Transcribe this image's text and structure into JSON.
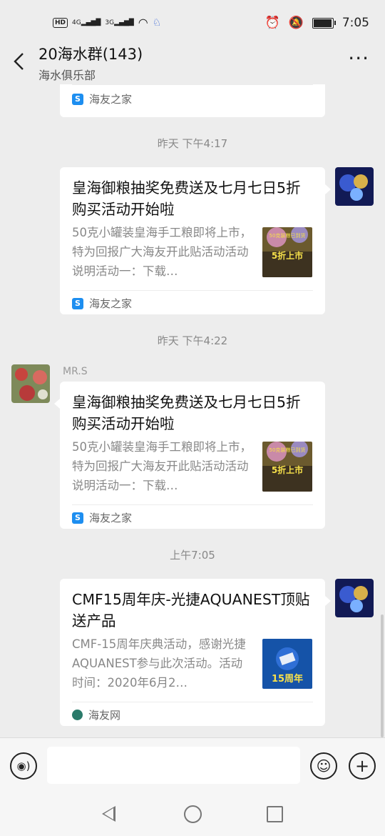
{
  "status_bar": {
    "hd_badge": "HD",
    "sim1": "4G",
    "sim2": "3G",
    "time": "7:05"
  },
  "header": {
    "title": "20海水群(143)",
    "subtitle": "海水俱乐部",
    "more_label": "···"
  },
  "messages": [
    {
      "kind": "partial-card",
      "source": "海友之家"
    },
    {
      "kind": "timestamp",
      "text": "昨天 下午4:17"
    },
    {
      "kind": "card",
      "side": "right",
      "title": "皇海御粮抽奖免费送及七月七日5折购买活动开始啦",
      "desc": "50克小罐装皇海手工粮即将上市，特为回报广大海友开此贴活动活动说明活动一：下载…",
      "thumb_caption_top": "50克装粮已到货",
      "thumb_caption": "5折上市",
      "source": "海友之家"
    },
    {
      "kind": "timestamp",
      "text": "昨天 下午4:22"
    },
    {
      "kind": "card",
      "side": "left",
      "sender": "MR.S",
      "title": "皇海御粮抽奖免费送及七月七日5折购买活动开始啦",
      "desc": "50克小罐装皇海手工粮即将上市，特为回报广大海友开此贴活动活动说明活动一：下载…",
      "thumb_caption_top": "50克装粮已到货",
      "thumb_caption": "5折上市",
      "source": "海友之家"
    },
    {
      "kind": "timestamp",
      "text": "上午7:05"
    },
    {
      "kind": "card",
      "side": "right",
      "title": "CMF15周年庆-光捷AQUANEST顶贴送产品",
      "desc": "CMF-15周年庆典活动，感谢光捷AQUANEST参与此次活动。活动时间：2020年6月2…",
      "thumb_caption": "15周年",
      "source": "海友网"
    }
  ],
  "input_bar": {
    "placeholder": ""
  },
  "colors": {
    "background": "#ededed",
    "card": "#ffffff",
    "accent_blue": "#1d8ef0"
  }
}
